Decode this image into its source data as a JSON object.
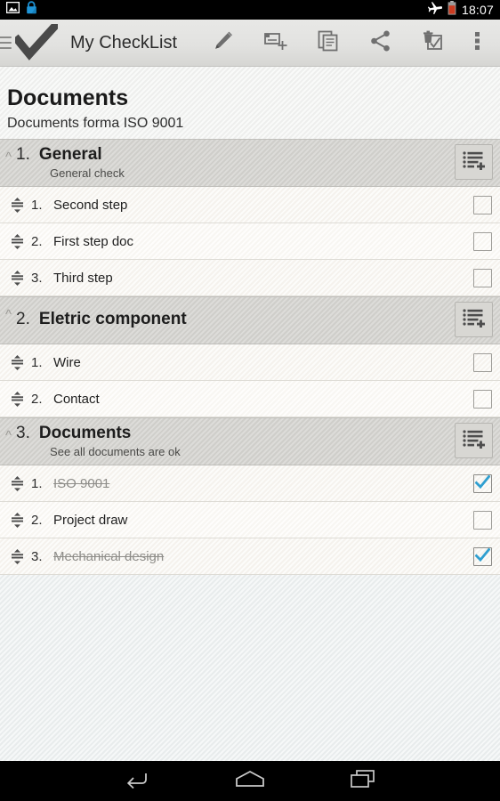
{
  "statusbar": {
    "time": "18:07",
    "icons": [
      "screenshot-icon",
      "lock-icon",
      "airplane-mode-icon",
      "battery-low-icon"
    ]
  },
  "appbar": {
    "menu_icon": "hamburger-icon",
    "logo_icon": "checkmark-logo",
    "title": "My CheckList",
    "actions": [
      {
        "name": "edit-button",
        "icon": "pencil-icon"
      },
      {
        "name": "add-group-button",
        "icon": "add-note-icon"
      },
      {
        "name": "duplicate-button",
        "icon": "copy-icon"
      },
      {
        "name": "share-button",
        "icon": "share-icon"
      },
      {
        "name": "delete-checked-button",
        "icon": "trash-checklist-icon"
      },
      {
        "name": "overflow-menu-button",
        "icon": "more-vertical-icon"
      }
    ]
  },
  "document": {
    "title": "Documents",
    "subtitle": "Documents forma ISO 9001"
  },
  "colors": {
    "checkbox_checked": "#2f9fd0",
    "appbar_bg": "#e2e2e0",
    "group_header_bg": "#d3d2ce",
    "page_bg": "#eceff0"
  },
  "groups": [
    {
      "index": "1.",
      "name": "General",
      "subtitle": "General check",
      "collapse_icon": "chevron-up-icon",
      "add_item_icon": "add-list-item-icon",
      "items": [
        {
          "index": "1.",
          "label": "Second  step",
          "checked": false
        },
        {
          "index": "2.",
          "label": "First step doc",
          "checked": false
        },
        {
          "index": "3.",
          "label": "Third step",
          "checked": false
        }
      ]
    },
    {
      "index": "2.",
      "name": "Eletric component",
      "subtitle": "",
      "collapse_icon": "chevron-up-icon",
      "add_item_icon": "add-list-item-icon",
      "items": [
        {
          "index": "1.",
          "label": "Wire",
          "checked": false
        },
        {
          "index": "2.",
          "label": "Contact",
          "checked": false
        }
      ]
    },
    {
      "index": "3.",
      "name": "Documents",
      "subtitle": "See all  documents are ok",
      "collapse_icon": "chevron-up-icon",
      "add_item_icon": "add-list-item-icon",
      "items": [
        {
          "index": "1.",
          "label": "ISO 9001",
          "checked": true
        },
        {
          "index": "2.",
          "label": "Project draw",
          "checked": false
        },
        {
          "index": "3.",
          "label": "Mechanical design",
          "checked": true
        }
      ]
    }
  ],
  "navbar": {
    "back": "back-icon",
    "home": "home-icon",
    "recents": "recents-icon"
  }
}
